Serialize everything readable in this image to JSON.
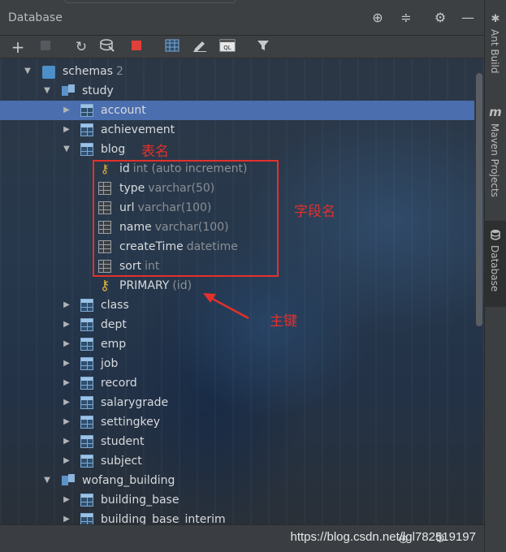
{
  "window": {
    "title": "Database",
    "controls": [
      "add-target-icon",
      "collapse-icon",
      "settings-icon",
      "minimize-icon"
    ]
  },
  "toolbar": {
    "buttons": [
      "add-icon",
      "copy-icon",
      "refresh-icon",
      "sync-icon",
      "stop-icon",
      "table-view-icon",
      "edit-icon",
      "console-icon",
      "filter-icon"
    ],
    "stop_color": "#e0403a",
    "console_label": "QL"
  },
  "tree": {
    "root": {
      "label": "schemas",
      "count": "2"
    },
    "schema1": {
      "label": "study"
    },
    "selected_table": "account",
    "tables_before": [
      "account",
      "achievement"
    ],
    "blog": {
      "label": "blog",
      "columns": [
        {
          "name": "id",
          "type": "int (auto increment)",
          "icon": "key-column-icon"
        },
        {
          "name": "type",
          "type": "varchar(50)",
          "icon": "column-icon"
        },
        {
          "name": "url",
          "type": "varchar(100)",
          "icon": "column-icon"
        },
        {
          "name": "name",
          "type": "varchar(100)",
          "icon": "column-icon"
        },
        {
          "name": "createTime",
          "type": "datetime",
          "icon": "column-icon"
        },
        {
          "name": "sort",
          "type": "int",
          "icon": "column-icon"
        }
      ],
      "primary_key": {
        "name": "PRIMARY",
        "detail": "(id)"
      }
    },
    "tables_after": [
      "class",
      "dept",
      "emp",
      "job",
      "record",
      "salarygrade",
      "settingkey",
      "student",
      "subject"
    ],
    "schema2": {
      "label": "wofang_building",
      "tables": [
        "building_base",
        "building_base_interim"
      ]
    }
  },
  "side_tabs": [
    {
      "label": "Ant Build",
      "icon": "ant-icon"
    },
    {
      "label": "Maven Projects",
      "icon": "maven-icon",
      "glyph": "m"
    },
    {
      "label": "Database",
      "icon": "database-icon",
      "active": true
    }
  ],
  "annotations": {
    "table_name": "表名",
    "field_names": "字段名",
    "primary_key": "主键",
    "color": "#e4302b"
  },
  "watermark": "https://blog.csdn.net/lgl782519197"
}
